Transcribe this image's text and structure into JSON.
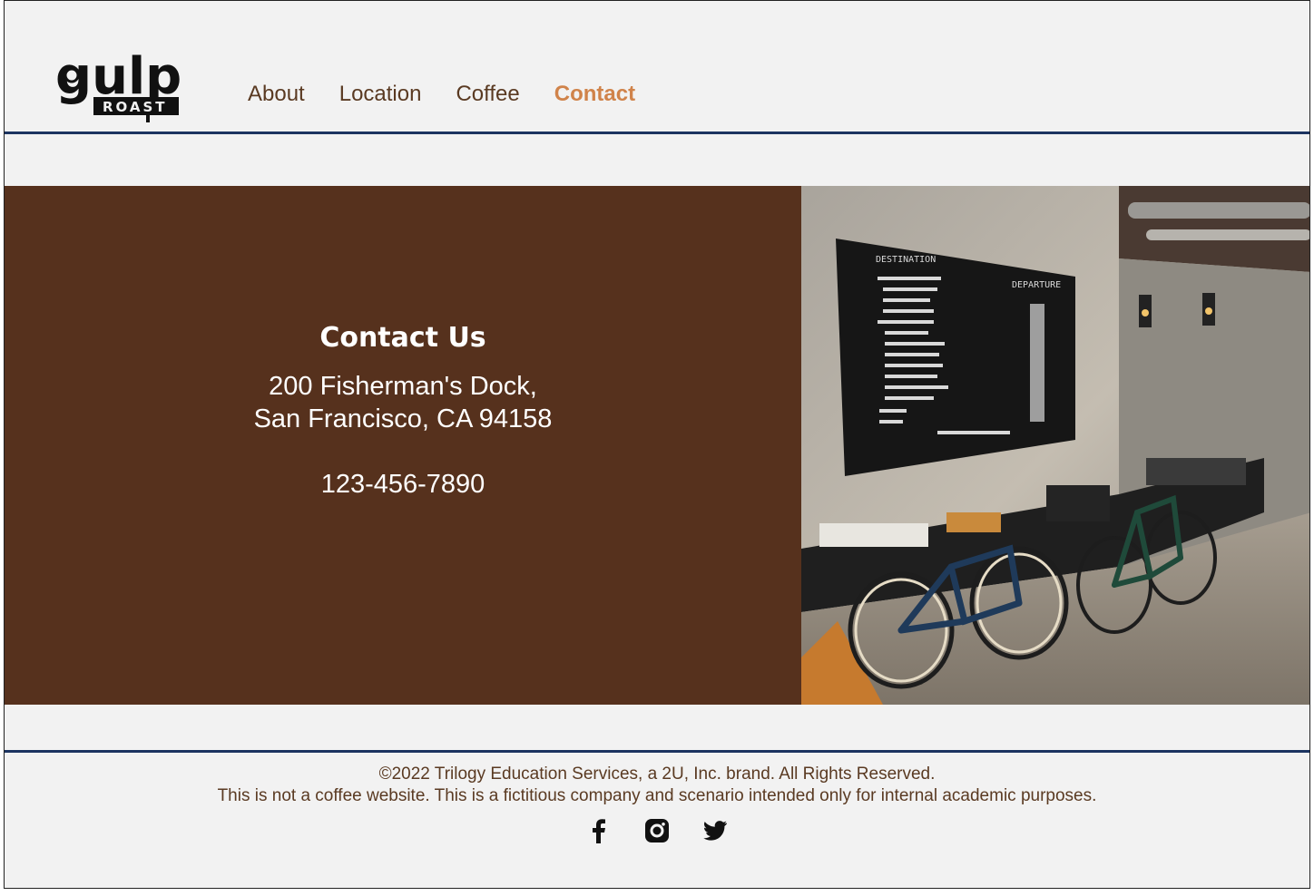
{
  "header": {
    "logo_text": "gulp",
    "logo_subtext": "ROAST",
    "nav": [
      {
        "label": "About"
      },
      {
        "label": "Location"
      },
      {
        "label": "Coffee"
      },
      {
        "label": "Contact"
      }
    ],
    "active_index": 3
  },
  "contact": {
    "title": "Contact Us",
    "address_line1": "200 Fisherman's Dock,",
    "address_line2": "San Francisco, CA 94158",
    "phone": "123-456-7890"
  },
  "footer": {
    "copyright": "©2022 Trilogy Education Services, a 2U, Inc. brand. All Rights Reserved.",
    "disclaimer": "This is not a coffee website. This is a fictitious company and scenario intended only for internal academic purposes.",
    "social_icons": [
      "facebook-icon",
      "instagram-icon",
      "twitter-icon"
    ]
  },
  "colors": {
    "brand_brown": "#56311d",
    "nav_text": "#5a3a22",
    "nav_active": "#d0834a",
    "rule_blue": "#1c3461",
    "page_bg": "#f2f2f2"
  }
}
